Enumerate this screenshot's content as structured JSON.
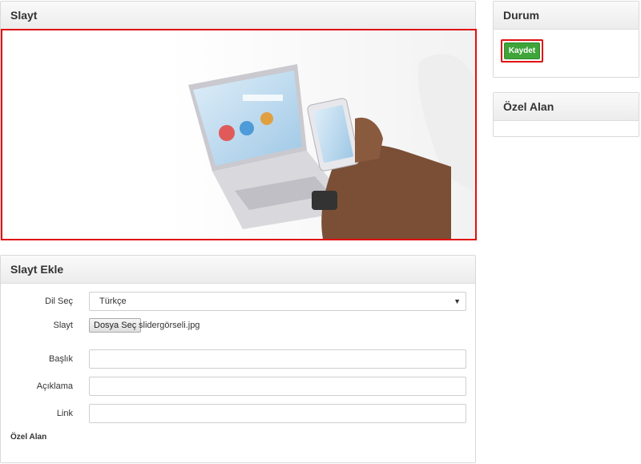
{
  "slide_panel": {
    "title": "Slayt"
  },
  "add_panel": {
    "title": "Slayt Ekle",
    "language": {
      "label": "Dil Seç",
      "value": "Türkçe"
    },
    "slide_file": {
      "label": "Slayt",
      "button": "Dosya Seç",
      "filename": "slidergörseli.jpg"
    },
    "title_field": {
      "label": "Başlık",
      "value": ""
    },
    "description_field": {
      "label": "Açıklama",
      "value": ""
    },
    "link_field": {
      "label": "Link",
      "value": ""
    },
    "custom_field_label": "Özel Alan"
  },
  "status_panel": {
    "title": "Durum",
    "save_label": "Kaydet"
  },
  "custom_panel": {
    "title": "Özel Alan"
  },
  "colors": {
    "save_green": "#3fa43a",
    "highlight_red": "#e01010"
  }
}
